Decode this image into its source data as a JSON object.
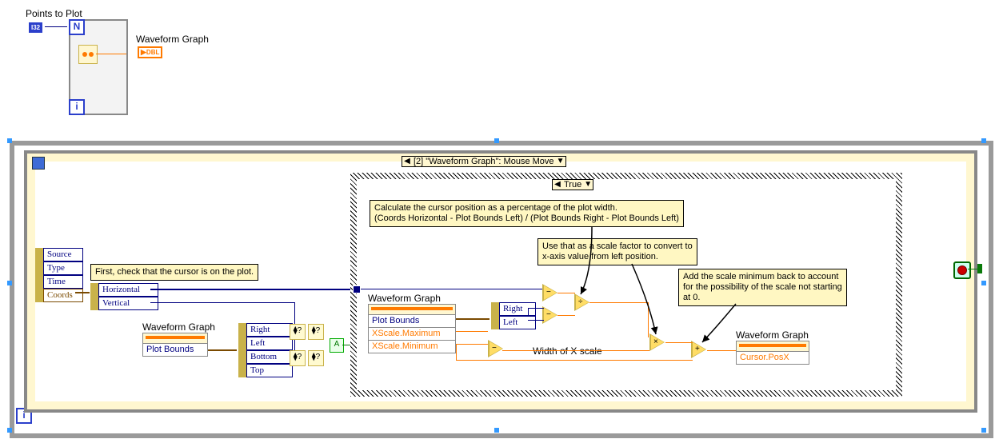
{
  "labels": {
    "points_to_plot": "Points to Plot",
    "waveform_graph_top": "Waveform Graph",
    "i32": "I32",
    "dbl": "DBL"
  },
  "outer_loop": {
    "n_label": "N",
    "i_label": "i"
  },
  "event": {
    "selector": "[2] \"Waveform Graph\": Mouse Move",
    "outer_i": "i",
    "reset_icon": "⟳"
  },
  "event_cluster": {
    "items": [
      "Source",
      "Type",
      "Time",
      "Coords"
    ]
  },
  "comment1": "First, check that the cursor is on the plot.",
  "hv_cluster": {
    "items": [
      "Horizontal",
      "Vertical"
    ]
  },
  "prop_bounds1": {
    "title": "Waveform Graph",
    "rows": [
      "Plot Bounds"
    ]
  },
  "bounds_cluster": {
    "items": [
      "Right",
      "Left",
      "Bottom",
      "Top"
    ]
  },
  "and_label": "A",
  "case": {
    "selector": "True",
    "comment_calc": "Calculate the cursor position as a percentage of the plot width.\n(Coords Horizontal - Plot Bounds Left) / (Plot Bounds Right - Plot Bounds Left)",
    "comment_scale": "Use that as a scale factor to convert to\nx-axis value from left position.",
    "comment_min": "Add the scale minimum back to account\nfor the possibility of the scale not starting\nat 0.",
    "prop_scale": {
      "title": "Waveform Graph",
      "rows": [
        "Plot Bounds",
        "XScale.Maximum",
        "XScale.Minimum"
      ]
    },
    "rl_cluster": {
      "items": [
        "Right",
        "Left"
      ]
    },
    "width_label": "Width of X scale",
    "prop_cursor": {
      "title": "Waveform Graph",
      "rows": [
        "Cursor.PosX"
      ]
    }
  }
}
